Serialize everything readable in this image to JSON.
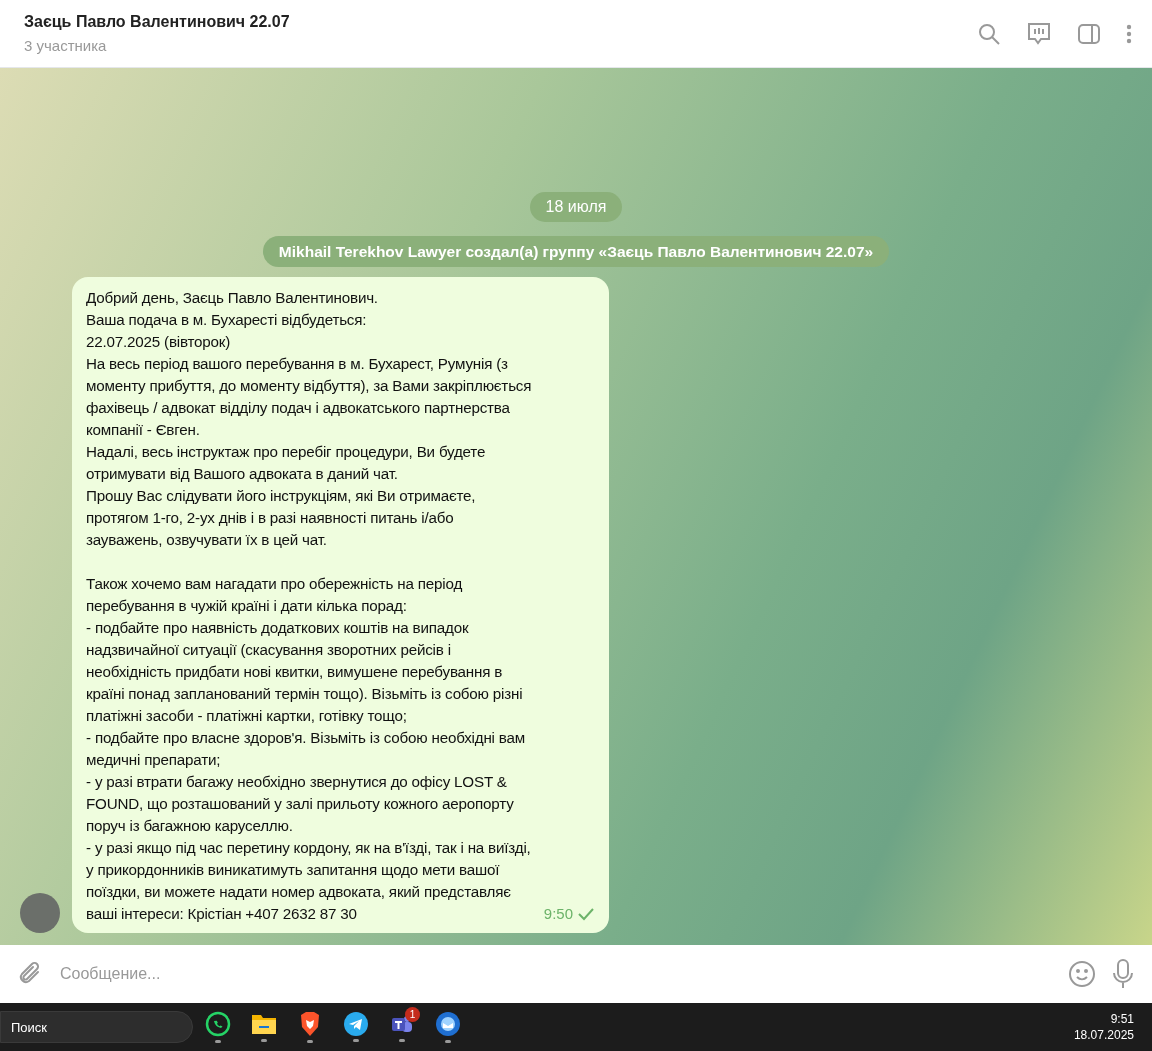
{
  "header": {
    "title": "Заєць Павло Валентинович 22.07",
    "subtitle": "3 участника"
  },
  "chat": {
    "date": "18 июля",
    "service_message": "Mikhail Terekhov Lawyer создал(а) группу «Заєць Павло Валентинович 22.07»",
    "message": {
      "text": "Добрий день, Заєць Павло Валентинович.\nВаша подача в м. Бухаресті відбудеться:\n22.07.2025 (вівторок)\nНа весь період вашого перебування в м. Бухарест, Румунія (з\nмоменту прибуття, до моменту відбуття), за Вами закріплюється\nфахівець / адвокат відділу подач і адвокатського партнерства\nкомпанії - Євген.\nНадалі, весь інструктаж про перебіг процедури, Ви будете\nотримувати від Вашого адвоката в даний чат.\nПрошу Вас слідувати його інструкціям, які Ви отримаєте,\nпротягом 1-го, 2-ух днів і в разі наявності питань і/або\nзауважень, озвучувати їх в цей чат.\n\nТакож хочемо вам нагадати про обережність на період\nперебування в чужій країні і дати кілька порад:\n- подбайте про наявність додаткових коштів на випадок\nнадзвичайної ситуації (скасування зворотних рейсів і\nнеобхідність придбати нові квитки, вимушене перебування в\nкраїні понад запланований термін тощо). Візьміть із собою різні\nплатіжні засоби - платіжні картки, готівку тощо;\n- подбайте про власне здоров'я. Візьміть із собою необхідні вам\nмедичні препарати;\n- у разі втрати багажу необхідно звернутися до офісу LOST &\nFOUND, що розташований у залі прильоту кожного аеропорту\nпоруч із багажною каруселлю.\n- у разі якщо під час перетину кордону, як на в'їзді, так і на виїзді,\nу прикордонників виникатимуть запитання щодо мети вашої\nпоїздки, ви можете надати номер адвоката, який представляє\nваші інтереси: Крістіан +407 2632 87 30",
      "time": "9:50",
      "read": true
    }
  },
  "composer": {
    "placeholder": "Сообщение..."
  },
  "taskbar": {
    "search": "Поиск",
    "apps": [
      {
        "kind": "whatsapp"
      },
      {
        "kind": "folder"
      },
      {
        "kind": "brave"
      },
      {
        "kind": "telegram"
      },
      {
        "kind": "teams",
        "badge": "1"
      },
      {
        "kind": "mail"
      }
    ],
    "time": "9:51",
    "date": "18.07.2025"
  }
}
